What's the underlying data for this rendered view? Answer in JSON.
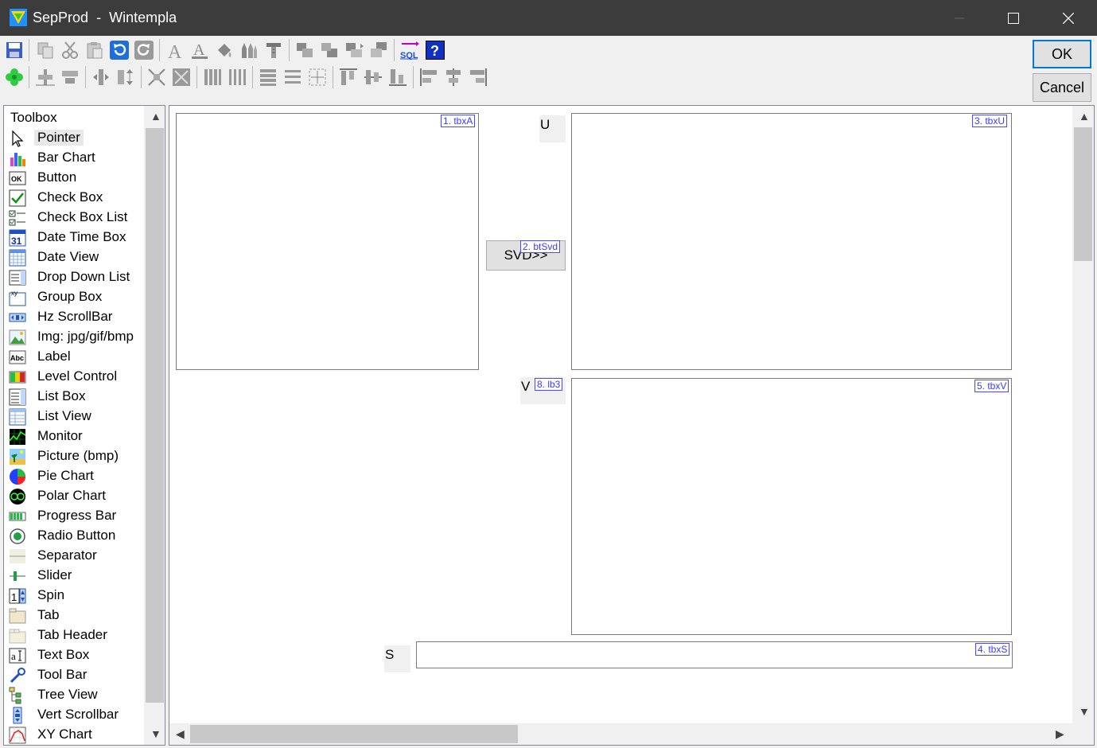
{
  "window": {
    "app_name": "SepProd",
    "separator": "-",
    "document": "Wintempla"
  },
  "dialog_buttons": {
    "ok": "OK",
    "cancel": "Cancel"
  },
  "toolbox": {
    "title": "Toolbox",
    "items": [
      {
        "label": "Pointer",
        "icon": "pointer-icon"
      },
      {
        "label": "Bar Chart",
        "icon": "bar-chart-icon"
      },
      {
        "label": "Button",
        "icon": "button-icon"
      },
      {
        "label": "Check Box",
        "icon": "check-box-icon"
      },
      {
        "label": "Check Box List",
        "icon": "check-box-list-icon"
      },
      {
        "label": "Date Time Box",
        "icon": "date-time-box-icon"
      },
      {
        "label": "Date View",
        "icon": "date-view-icon"
      },
      {
        "label": "Drop Down List",
        "icon": "drop-down-list-icon"
      },
      {
        "label": "Group Box",
        "icon": "group-box-icon"
      },
      {
        "label": "Hz ScrollBar",
        "icon": "hz-scrollbar-icon"
      },
      {
        "label": "Img: jpg/gif/bmp",
        "icon": "image-icon"
      },
      {
        "label": "Label",
        "icon": "label-icon"
      },
      {
        "label": "Level Control",
        "icon": "level-control-icon"
      },
      {
        "label": "List Box",
        "icon": "list-box-icon"
      },
      {
        "label": "List View",
        "icon": "list-view-icon"
      },
      {
        "label": "Monitor",
        "icon": "monitor-icon"
      },
      {
        "label": "Picture (bmp)",
        "icon": "picture-icon"
      },
      {
        "label": "Pie Chart",
        "icon": "pie-chart-icon"
      },
      {
        "label": "Polar Chart",
        "icon": "polar-chart-icon"
      },
      {
        "label": "Progress Bar",
        "icon": "progress-bar-icon"
      },
      {
        "label": "Radio Button",
        "icon": "radio-button-icon"
      },
      {
        "label": "Separator",
        "icon": "separator-icon"
      },
      {
        "label": "Slider",
        "icon": "slider-icon"
      },
      {
        "label": "Spin",
        "icon": "spin-icon"
      },
      {
        "label": "Tab",
        "icon": "tab-icon"
      },
      {
        "label": "Tab Header",
        "icon": "tab-header-icon"
      },
      {
        "label": "Text Box",
        "icon": "text-box-icon"
      },
      {
        "label": "Tool Bar",
        "icon": "tool-bar-icon"
      },
      {
        "label": "Tree View",
        "icon": "tree-view-icon"
      },
      {
        "label": "Vert Scrollbar",
        "icon": "vert-scrollbar-icon"
      },
      {
        "label": "XY Chart",
        "icon": "xy-chart-icon"
      }
    ],
    "selected": "Pointer"
  },
  "design": {
    "tbxA_tag": "1. tbxA",
    "btSvd_tag": "2. btSvd",
    "btSvd_text": "SVD>>",
    "tbxU_tag": "3. tbxU",
    "tbxS_tag": "4. tbxS",
    "tbxV_tag": "5. tbxV",
    "lb3_tag": "8. lb3",
    "label_u": "U",
    "label_v": "V",
    "label_s": "S"
  },
  "colors": {
    "tag_border": "#4848ff",
    "tag_text": "#3a3aff",
    "titlebar": "#3c3c3c",
    "ok_border": "#0078d7"
  }
}
